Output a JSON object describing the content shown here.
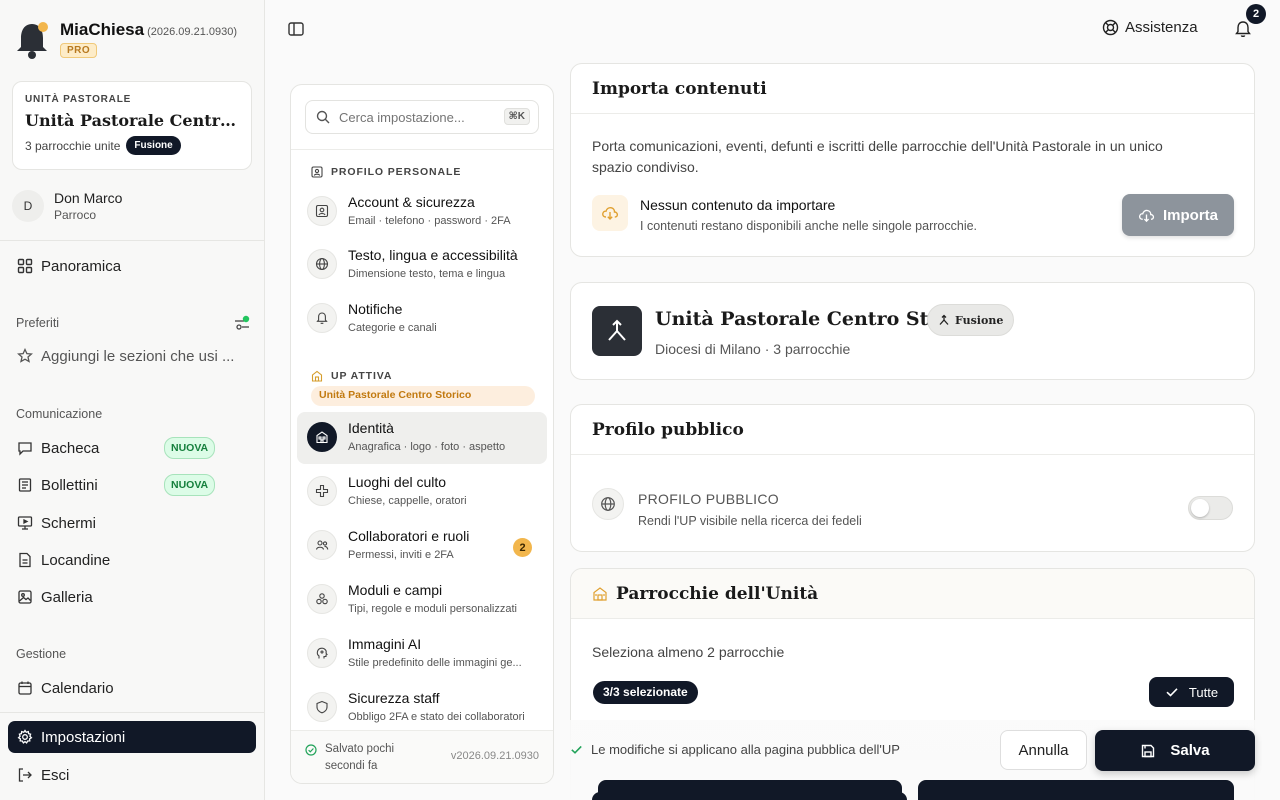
{
  "app": {
    "name": "MiaChiesa",
    "version": "(2026.09.21.0930)",
    "plan": "PRO"
  },
  "up_card": {
    "kicker": "UNITÀ PASTORALE",
    "title": "Unità Pastorale Centro Sto...",
    "parishes": "3 parrocchie unite",
    "badge": "Fusione"
  },
  "user": {
    "initial": "D",
    "name": "Don Marco",
    "role": "Parroco"
  },
  "nav": {
    "overview": "Panoramica",
    "favorites_title": "Preferiti",
    "favorites_hint": "Aggiungi le sezioni che usi ...",
    "comm_title": "Comunicazione",
    "comm": [
      {
        "label": "Bacheca",
        "badge": "NUOVA"
      },
      {
        "label": "Bollettini",
        "badge": "NUOVA"
      },
      {
        "label": "Schermi"
      },
      {
        "label": "Locandine"
      },
      {
        "label": "Galleria"
      }
    ],
    "mgmt_title": "Gestione",
    "calendar": "Calendario",
    "settings": "Impostazioni",
    "logout": "Esci"
  },
  "topbar": {
    "assist": "Assistenza",
    "notif_count": "2"
  },
  "settings": {
    "search_placeholder": "Cerca impostazione...",
    "shortcut": "⌘K",
    "personal_title": "PROFILO PERSONALE",
    "personal": [
      {
        "title": "Account & sicurezza",
        "sub": "Email · telefono · password · 2FA"
      },
      {
        "title": "Testo, lingua e accessibilità",
        "sub": "Dimensione testo, tema e lingua"
      },
      {
        "title": "Notifiche",
        "sub": "Categorie e canali"
      }
    ],
    "up_title": "UP ATTIVA",
    "up_name": "Unità Pastorale Centro Storico",
    "up_items": [
      {
        "title": "Identità",
        "sub": "Anagrafica · logo · foto · aspetto"
      },
      {
        "title": "Luoghi del culto",
        "sub": "Chiese, cappelle, oratori"
      },
      {
        "title": "Collaboratori e ruoli",
        "sub": "Permessi, inviti e 2FA",
        "count": "2"
      },
      {
        "title": "Moduli e campi",
        "sub": "Tipi, regole e moduli personalizzati"
      },
      {
        "title": "Immagini AI",
        "sub": "Stile predefinito delle immagini ge..."
      },
      {
        "title": "Sicurezza staff",
        "sub": "Obbligo 2FA e stato dei collaboratori"
      }
    ],
    "saved_line1": "Salvato pochi",
    "saved_line2": "secondi fa",
    "version": "v2026.09.21.0930"
  },
  "import": {
    "title": "Importa contenuti",
    "desc": "Porta comunicazioni, eventi, defunti e iscritti delle parrocchie dell'Unità Pastorale in un unico spazio condiviso.",
    "empty_title": "Nessun contenuto da importare",
    "empty_sub": "I contenuti restano disponibili anche nelle singole parrocchie.",
    "button": "Importa"
  },
  "up_info": {
    "name": "Unità Pastorale Centro Storico",
    "badge": "Fusione",
    "meta": "Diocesi di Milano · 3 parrocchie"
  },
  "public_profile": {
    "title": "Profilo pubblico",
    "label": "PROFILO PUBBLICO",
    "sub": "Rendi l'UP visibile nella ricerca dei fedeli",
    "enabled": false
  },
  "parishes": {
    "title": "Parrocchie dell'Unità",
    "hint": "Seleziona almeno 2 parrocchie",
    "selected": "3/3 selezionate",
    "all_button": "Tutte"
  },
  "actions": {
    "note": "Le modifiche si applicano alla pagina pubblica dell'UP",
    "cancel": "Annulla",
    "save": "Salva"
  },
  "colors": {
    "primary": "#111827",
    "accent": "#f2b64c",
    "success": "#22c55e"
  }
}
